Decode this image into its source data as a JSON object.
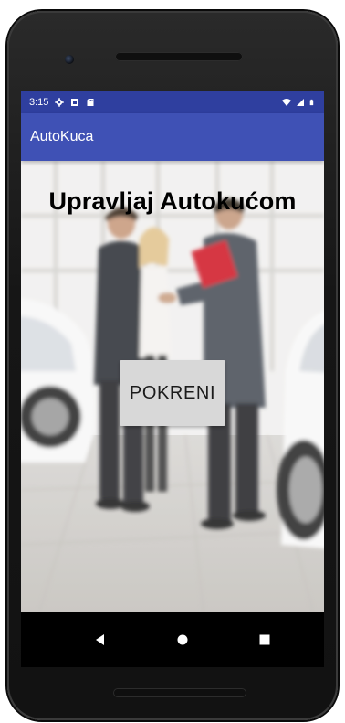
{
  "status_bar": {
    "time": "3:15",
    "background": "#2f3f9f",
    "left_icons": [
      "gear-icon",
      "media-icon",
      "sd-card-icon"
    ],
    "right_icons": [
      "wifi-icon",
      "signal-icon",
      "battery-icon"
    ]
  },
  "app_bar": {
    "title": "AutoKuca",
    "background": "#3f51b5"
  },
  "main": {
    "headline": "Upravljaj Autokućom",
    "start_button_label": "POKRENI",
    "start_button_background": "#d8d8d8"
  },
  "nav_bar": {
    "icons": [
      "back-icon",
      "home-icon",
      "recents-icon"
    ]
  }
}
